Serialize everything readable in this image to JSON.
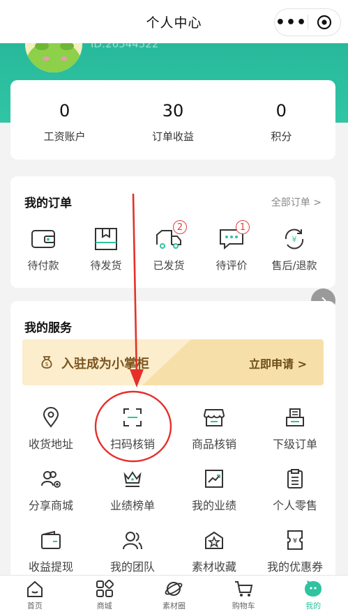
{
  "nav": {
    "title": "个人中心",
    "more_glyph": "•••"
  },
  "profile": {
    "id_text": "ID:26544522"
  },
  "stats": [
    {
      "value": "0",
      "label": "工资账户"
    },
    {
      "value": "30",
      "label": "订单收益"
    },
    {
      "value": "0",
      "label": "积分"
    }
  ],
  "orders": {
    "title": "我的订单",
    "all_label": "全部订单 >",
    "items": [
      {
        "label": "待付款",
        "icon": "wallet-icon",
        "badge": ""
      },
      {
        "label": "待发货",
        "icon": "package-icon",
        "badge": ""
      },
      {
        "label": "已发货",
        "icon": "truck-icon",
        "badge": "2"
      },
      {
        "label": "待评价",
        "icon": "comment-icon",
        "badge": "1"
      },
      {
        "label": "售后/退款",
        "icon": "refund-icon",
        "badge": ""
      }
    ]
  },
  "services": {
    "title": "我的服务",
    "banner": {
      "text": "入驻成为小掌柜",
      "apply_label": "立即申请 >"
    },
    "items": [
      {
        "label": "收货地址",
        "icon": "location-icon"
      },
      {
        "label": "扫码核销",
        "icon": "scan-icon"
      },
      {
        "label": "商品核销",
        "icon": "shop-icon"
      },
      {
        "label": "下级订单",
        "icon": "order-tray-icon"
      },
      {
        "label": "分享商城",
        "icon": "share-users-icon"
      },
      {
        "label": "业绩榜单",
        "icon": "crown-icon"
      },
      {
        "label": "我的业绩",
        "icon": "trend-chart-icon"
      },
      {
        "label": "个人零售",
        "icon": "clipboard-icon"
      },
      {
        "label": "收益提现",
        "icon": "withdraw-wallet-icon"
      },
      {
        "label": "我的团队",
        "icon": "team-icon"
      },
      {
        "label": "素材收藏",
        "icon": "star-box-icon"
      },
      {
        "label": "我的优惠券",
        "icon": "coupon-icon"
      }
    ]
  },
  "tabbar": [
    {
      "label": "首页",
      "icon": "home-icon"
    },
    {
      "label": "商城",
      "icon": "grid-apps-icon"
    },
    {
      "label": "素材圈",
      "icon": "planet-icon"
    },
    {
      "label": "购物车",
      "icon": "cart-icon"
    },
    {
      "label": "我的",
      "icon": "me-face-icon",
      "active": true
    }
  ],
  "colors": {
    "accent": "#2fc3a0",
    "annotation_red": "#e5302a",
    "badge_red": "#e23d3d",
    "banner_text": "#7a5520"
  }
}
